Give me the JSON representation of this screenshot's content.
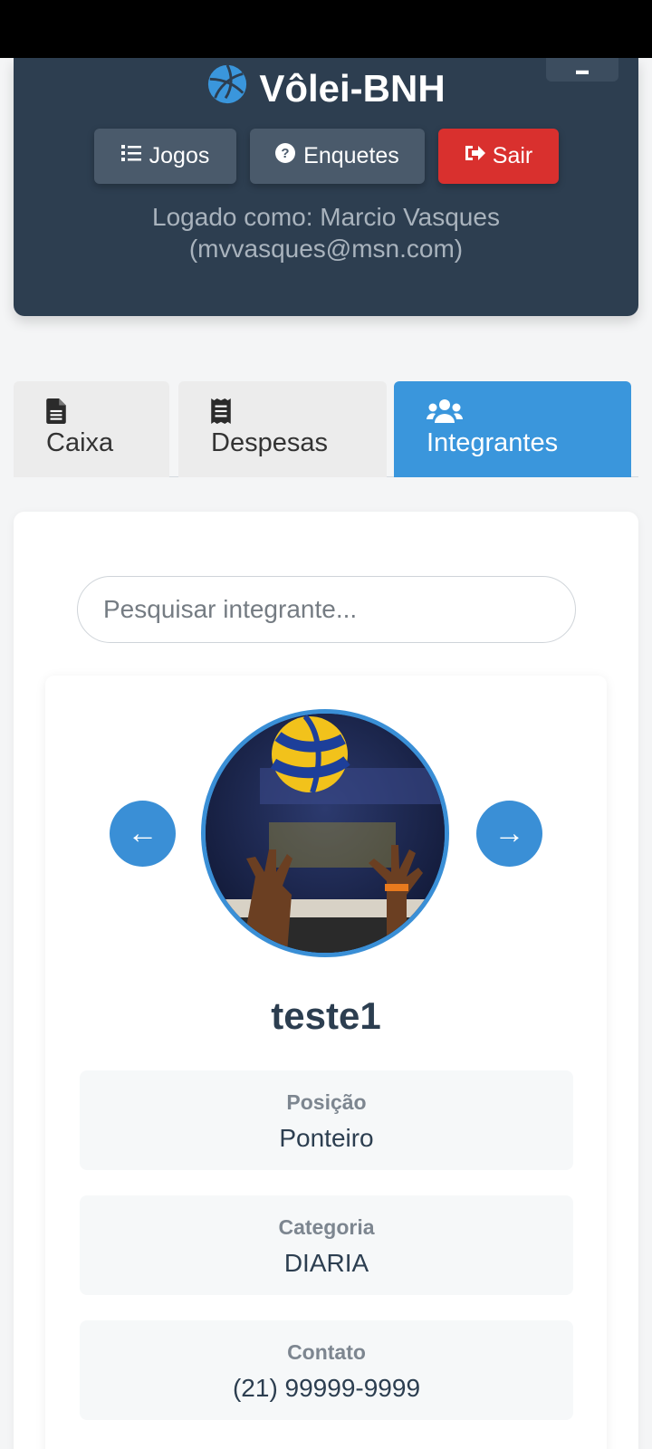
{
  "header": {
    "app_title": "Vôlei-BNH",
    "nav": {
      "jogos_label": "Jogos",
      "enquetes_label": "Enquetes",
      "sair_label": "Sair"
    },
    "logged_line1": "Logado como: Marcio Vasques",
    "logged_line2": "(mvvasques@msn.com)"
  },
  "tabs": [
    {
      "label": "Caixa",
      "icon": "file-icon",
      "active": false
    },
    {
      "label": "Despesas",
      "icon": "receipt-icon",
      "active": false
    },
    {
      "label": "Integrantes",
      "icon": "users-icon",
      "active": true
    }
  ],
  "search": {
    "placeholder": "Pesquisar integrante...",
    "value": ""
  },
  "member": {
    "prev_arrow": "←",
    "next_arrow": "→",
    "name": "teste1",
    "fields": [
      {
        "label": "Posição",
        "value": "Ponteiro"
      },
      {
        "label": "Categoria",
        "value": "DIARIA"
      },
      {
        "label": "Contato",
        "value": "(21) 99999-9999"
      }
    ]
  },
  "colors": {
    "header_bg": "#2d3e50",
    "accent": "#3a96dc",
    "danger": "#d9302e"
  }
}
